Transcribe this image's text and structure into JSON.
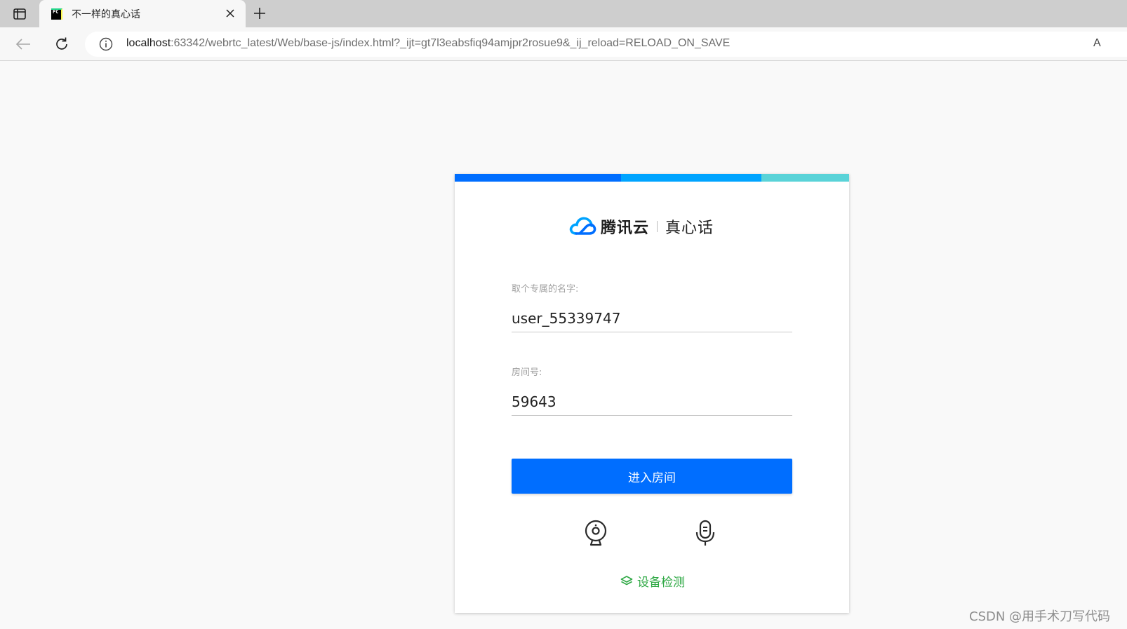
{
  "browser": {
    "tab": {
      "title": "不一样的真心话",
      "favicon_text": "PC",
      "favicon_icon": "pycharm-icon"
    },
    "url": {
      "host": "localhost",
      "rest": ":63342/webrtc_latest/Web/base-js/index.html?_ijt=gt7l3eabsfiq94amjpr2rosue9&_ij_reload=RELOAD_ON_SAVE"
    },
    "reader_label": "A",
    "icons": [
      "tab-actions-icon",
      "close-icon",
      "plus-icon",
      "back-arrow-icon",
      "refresh-icon",
      "info-icon"
    ]
  },
  "card": {
    "accent_colors": [
      "#006eff",
      "#00a4ff",
      "#5ad3d8"
    ],
    "logo": {
      "brand": "腾讯云",
      "product": "真心话",
      "icon": "tencent-cloud-icon"
    },
    "username": {
      "label": "取个专属的名字:",
      "value": "user_55339747"
    },
    "room": {
      "label": "房间号:",
      "value": "59643"
    },
    "enter_button": "进入房间",
    "device_icons": [
      "camera-icon",
      "microphone-icon"
    ],
    "device_check": "设备检测",
    "primary_color": "#006eff",
    "success_color": "#2da843"
  },
  "watermark": "CSDN @用手术刀写代码"
}
